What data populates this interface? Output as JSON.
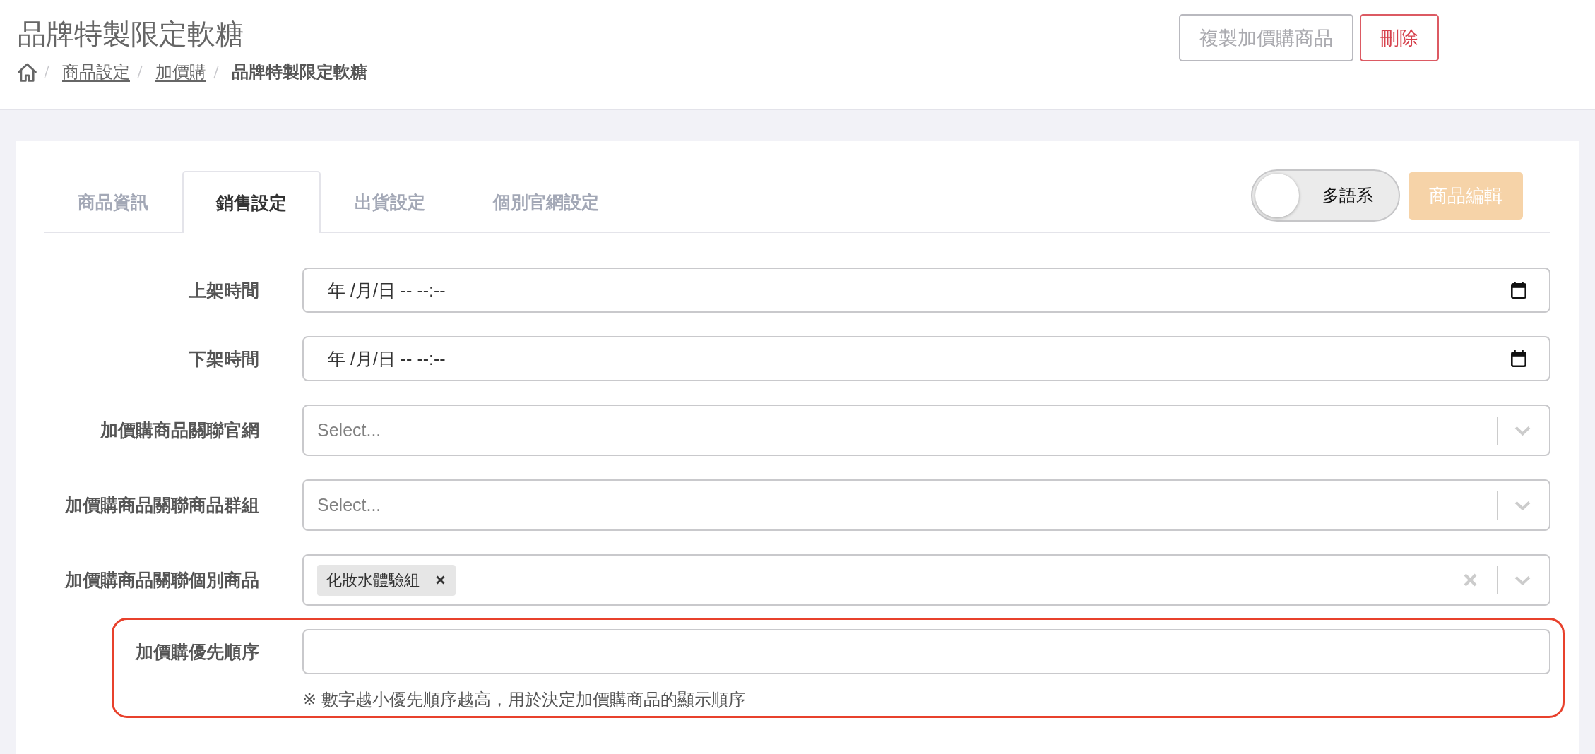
{
  "header": {
    "title": "品牌特製限定軟糖",
    "breadcrumb": [
      {
        "label": "商品設定",
        "link": true
      },
      {
        "label": "加價購",
        "link": true
      },
      {
        "label": "品牌特製限定軟糖",
        "link": false
      }
    ],
    "buttons": [
      {
        "label": "複製加價購商品",
        "kind": "outline"
      },
      {
        "label": "刪除",
        "kind": "danger"
      }
    ]
  },
  "tabs": [
    {
      "label": "商品資訊",
      "selected": false
    },
    {
      "label": "銷售設定",
      "selected": true
    },
    {
      "label": "出貨設定",
      "selected": false
    },
    {
      "label": "個別官網設定",
      "selected": false
    }
  ],
  "language_toggle": {
    "label": "多語系",
    "on": false
  },
  "edit_button": {
    "label": "商品編輯",
    "disabled": true
  },
  "fields": [
    {
      "kind": "datetime",
      "label": "上架時間",
      "placeholder": "年 /月/日 -- --:--",
      "highlighted": false
    },
    {
      "kind": "datetime",
      "label": "下架時間",
      "placeholder": "年 /月/日 -- --:--",
      "highlighted": false
    },
    {
      "kind": "select",
      "label": "加價購商品關聯官網",
      "placeholder": "Select...",
      "highlighted": false
    },
    {
      "kind": "select",
      "label": "加價購商品關聯商品群組",
      "placeholder": "Select...",
      "highlighted": false
    },
    {
      "kind": "multiselect",
      "label": "加價購商品關聯個別商品",
      "tags": [
        "化妝水體驗組"
      ],
      "highlighted": false
    },
    {
      "kind": "number",
      "label": "加價購優先順序",
      "hint": "※ 數字越小優先順序越高，用於決定加價購商品的顯示順序",
      "highlighted": true
    }
  ]
}
